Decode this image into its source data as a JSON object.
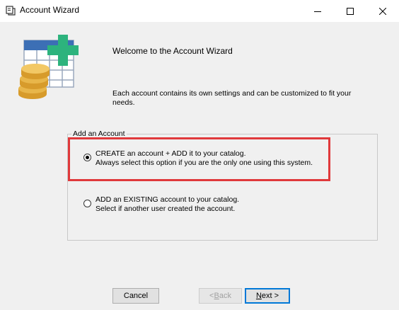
{
  "window": {
    "title": "Account Wizard"
  },
  "header": {
    "welcome": "Welcome to the Account Wizard",
    "description": "Each account contains its own settings and can be customized to fit your needs."
  },
  "group": {
    "legend": "Add an Account",
    "options": [
      {
        "line1": "CREATE an account + ADD it to your catalog.",
        "line2": "Always select this option if you are the only one using this system.",
        "selected": true
      },
      {
        "line1": "ADD an EXISTING account to your catalog.",
        "line2": "Select if another user created the account.",
        "selected": false
      }
    ]
  },
  "buttons": {
    "cancel": "Cancel",
    "back_prefix": "< ",
    "back_accel": "B",
    "back_rest": "ack",
    "next_accel": "N",
    "next_rest": "ext >"
  },
  "colors": {
    "highlight": "#e0393b",
    "table_blue": "#3c6fb5",
    "plus_green": "#2db37d",
    "coin_gold": "#e8b64a"
  },
  "icons": {
    "app": "wizard-app-icon",
    "minimize": "minimize-icon",
    "maximize": "maximize-icon",
    "close": "close-icon",
    "logo": "spreadsheet-coins-plus-icon"
  }
}
